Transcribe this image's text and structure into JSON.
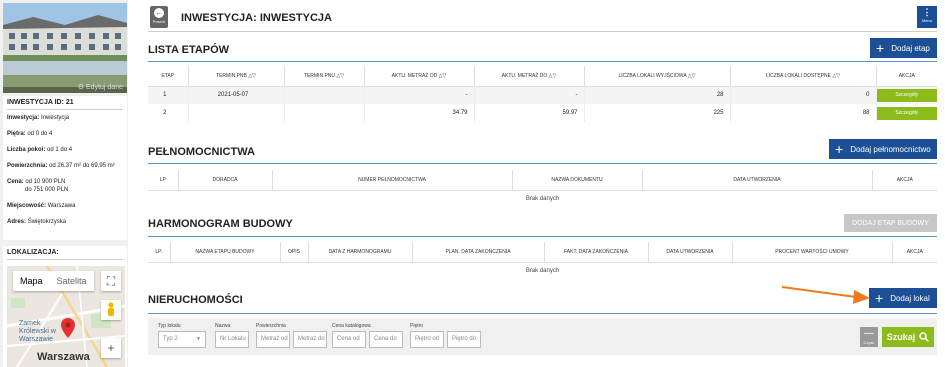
{
  "sidebar": {
    "edit_label": "Edytuj dane",
    "investment_id_label": "INWESTYCJA ID: 21",
    "info": [
      {
        "label": "Inwestycja:",
        "value": "Inwestycja"
      },
      {
        "label": "Piętra:",
        "value": "od 0 do 4"
      },
      {
        "label": "Liczba pokoi:",
        "value": "od 1 do 4"
      },
      {
        "label": "Powierzchnia:",
        "value": "od 26.37 m² do 69.95 m²"
      },
      {
        "label": "Cena:",
        "value": "od 10 900 PLN"
      },
      {
        "label": "",
        "value": "do 751 000 PLN"
      },
      {
        "label": "Miejscowość:",
        "value": "Warszawa"
      },
      {
        "label": "Adres:",
        "value": "Świętokrzyska"
      }
    ],
    "location_title": "LOKALIZACJA:",
    "map": {
      "tab_map": "Mapa",
      "tab_satellite": "Satelita",
      "label_castle": "Zamek Królewski w Warszawie",
      "label_city": "Warszawa"
    }
  },
  "header": {
    "back_label": "Powrót",
    "title": "INWESTYCJA: INWESTYCJA",
    "menu_label": "Menu"
  },
  "stages": {
    "title": "LISTA ETAPÓW",
    "add_label": "Dodaj etap",
    "columns": [
      "ETAP",
      "TERMIN PNB",
      "TERMIN PNU",
      "AKTU. METRAŻ OD",
      "AKTU. METRAŻ DO",
      "LICZBA LOKALI WYJŚCIOWA",
      "LICZBA LOKALI DOSTĘPNE",
      "AKCJA"
    ],
    "rows": [
      {
        "etap": "1",
        "pnb": "2021-05-07",
        "pnu": "",
        "od": "-",
        "do": "-",
        "wyj": "28",
        "dost": "0",
        "action": "Szczegóły"
      },
      {
        "etap": "2",
        "pnb": "",
        "pnu": "",
        "od": "34.79",
        "do": "59.97",
        "wyj": "225",
        "dost": "88",
        "action": "Szczegóły"
      }
    ]
  },
  "poa": {
    "title": "PEŁNOMOCNICTWA",
    "add_label": "Dodaj pełnomocnictwo",
    "columns": [
      "LP",
      "DORADCA",
      "NUMER PEŁNOMOCNICTWA",
      "NAZWA DOKUMENTU",
      "DATA UTWORZENIA",
      "AKCJA"
    ],
    "empty": "Brak danych"
  },
  "schedule": {
    "title": "HARMONOGRAM BUDOWY",
    "add_label": "DODAJ ETAP BUDOWY",
    "columns": [
      "LP.",
      "NAZWA ETAPU BUDOWY",
      "OPIS",
      "DATA Z HARMONOGRAMU",
      "PLAN. DATA ZAKOŃCZENIA",
      "FAKT. DATA ZAKOŃCZENIA",
      "DATA UTWORZENIA",
      "PROCENT WARTOŚCI UMOWY",
      "AKCJA"
    ],
    "empty": "Brak danych"
  },
  "properties": {
    "title": "NIERUCHOMOŚCI",
    "add_label": "Dodaj lokal",
    "filters": {
      "type_label": "Typ lokalu",
      "type_value": "Typ 2",
      "name_label": "Nazwa",
      "name_ph": "Nr Lokalu",
      "area_label": "Powierzchnia",
      "area_from_ph": "Metraż od",
      "area_to_ph": "Metraż do",
      "price_label": "Cena katalogowa",
      "price_from_ph": "Cena od",
      "price_to_ph": "Cena do",
      "floor_label": "Piętro",
      "floor_from_ph": "Piętro od",
      "floor_to_ph": "Piętro do",
      "clear_label": "Czyść",
      "search_label": "Szukaj"
    }
  },
  "colors": {
    "primary": "#1d4f94",
    "success": "#8bbc1c",
    "accent_arrow": "#f07a1c"
  }
}
